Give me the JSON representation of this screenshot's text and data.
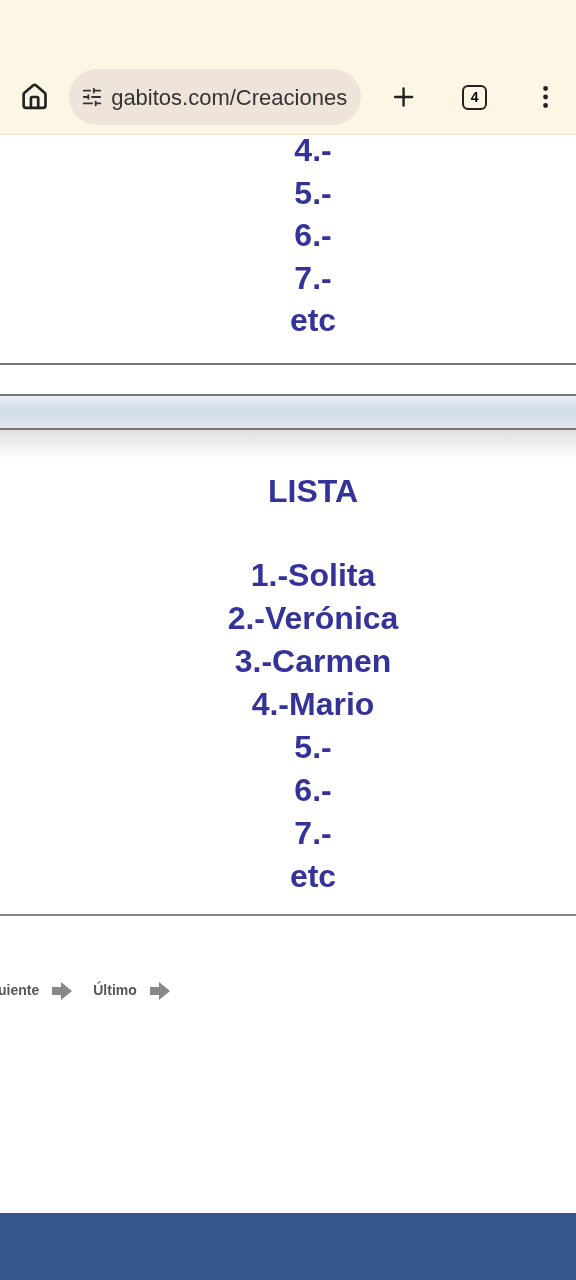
{
  "browser": {
    "url": "gabitos.com/Creaciones",
    "tab_count": "4"
  },
  "top_list": [
    "4.-",
    "5.-",
    "6.-",
    "7.-",
    "etc"
  ],
  "list": {
    "title": "LISTA",
    "items": [
      "1.-Solita",
      "2.-Verónica",
      "3.-Carmen",
      "4.-Mario",
      "5.-",
      "6.-",
      "7.-",
      "etc"
    ]
  },
  "pager": [
    "uiente",
    "Último"
  ]
}
